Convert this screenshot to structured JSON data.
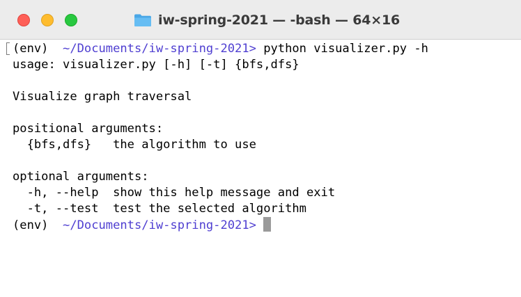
{
  "window": {
    "title": "iw-spring-2021 — -bash — 64×16",
    "folder_icon": "folder-icon"
  },
  "colors": {
    "path": "#4f3fd1",
    "close": "#fe5f57",
    "minimize": "#febc2e",
    "zoom": "#28c840",
    "cursor": "#9a9a9a"
  },
  "terminal": {
    "lines": [
      {
        "prompt_env": "(env)  ",
        "path": "~/Documents/iw-spring-2021>",
        "command": " python visualizer.py -h"
      },
      {
        "text": "usage: visualizer.py [-h] [-t] {bfs,dfs}"
      },
      {
        "text": ""
      },
      {
        "text": "Visualize graph traversal"
      },
      {
        "text": ""
      },
      {
        "text": "positional arguments:"
      },
      {
        "text": "  {bfs,dfs}   the algorithm to use"
      },
      {
        "text": ""
      },
      {
        "text": "optional arguments:"
      },
      {
        "text": "  -h, --help  show this help message and exit"
      },
      {
        "text": "  -t, --test  test the selected algorithm"
      },
      {
        "prompt_env": "(env)  ",
        "path": "~/Documents/iw-spring-2021>",
        "command": " "
      }
    ]
  }
}
